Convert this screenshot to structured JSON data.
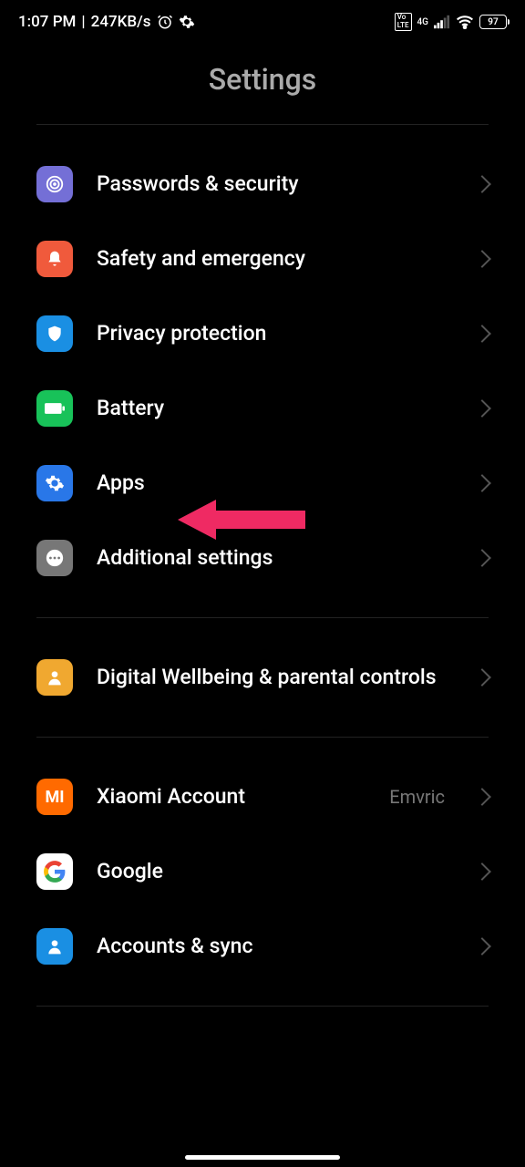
{
  "statusbar": {
    "time": "1:07 PM",
    "divider": " | ",
    "speed": "247KB/s",
    "battery": "97",
    "net_label": "4G",
    "volte": "Vo LTE"
  },
  "header": {
    "title": "Settings"
  },
  "sections": [
    {
      "items": [
        {
          "label": "Passwords & security"
        },
        {
          "label": "Safety and emergency"
        },
        {
          "label": "Privacy protection"
        },
        {
          "label": "Battery"
        },
        {
          "label": "Apps"
        },
        {
          "label": "Additional settings"
        }
      ]
    },
    {
      "items": [
        {
          "label": "Digital Wellbeing & parental controls"
        }
      ]
    },
    {
      "items": [
        {
          "label": "Xiaomi Account",
          "value": "Emvric"
        },
        {
          "label": "Google"
        },
        {
          "label": "Accounts & sync"
        }
      ]
    }
  ]
}
